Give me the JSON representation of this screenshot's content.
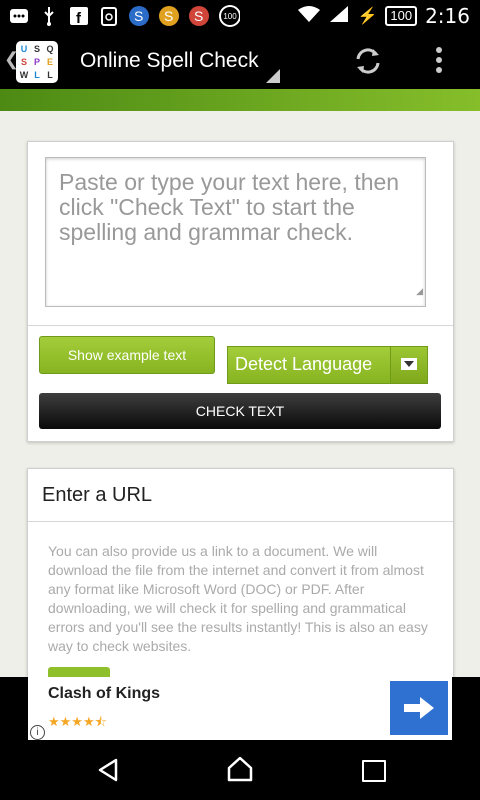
{
  "status_bar": {
    "time": "2:16",
    "battery": "100",
    "notification_icons": [
      "bbm-icon",
      "usb-icon",
      "facebook-icon",
      "clipboard-icon",
      "swiftkey-icon",
      "swiftkey-icon",
      "swiftkey-icon",
      "badge-100-icon"
    ],
    "badge_count": "100"
  },
  "app_bar": {
    "title": "Online Spell Check",
    "logo_letters": [
      "U",
      "S",
      "Q",
      "S",
      "P",
      "E",
      "W",
      "L",
      "L"
    ],
    "refresh_icon": "refresh-icon",
    "overflow_icon": "overflow-menu-icon"
  },
  "check_card": {
    "textarea_placeholder": "Paste or type your text here, then click \"Check Text\" to start the spelling and grammar check.",
    "example_button": "Show example text",
    "language_select": "Detect Language",
    "check_button": "CHECK TEXT"
  },
  "url_card": {
    "title": "Enter a URL",
    "description": "You can also provide us a link to a document. We will download the file from the internet and convert it from almost any format like Microsoft Word (DOC) or PDF. After downloading, we will check it for spelling and grammatical errors and you'll see the results instantly! This is also an easy way to check websites."
  },
  "ad": {
    "title": "Clash of Kings",
    "rating": 4.5,
    "stars": "★★★★⯪"
  },
  "colors": {
    "accent_green": "#86b420",
    "app_bar": "#000000",
    "ad_button": "#2f71d0"
  }
}
